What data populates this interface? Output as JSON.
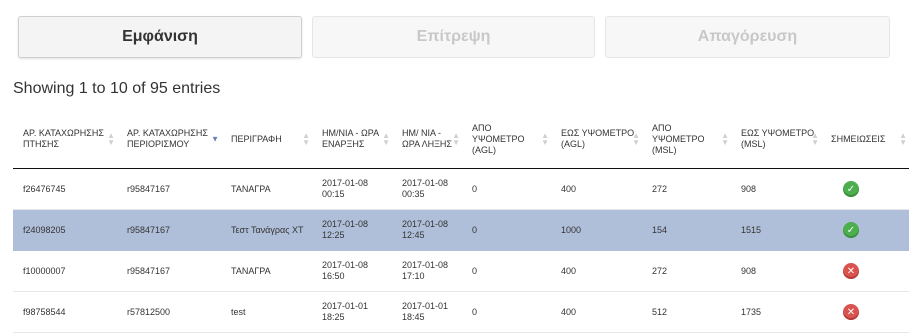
{
  "tabs": [
    {
      "label": "Εμφάνιση",
      "active": true
    },
    {
      "label": "Επίτρεψη",
      "active": false
    },
    {
      "label": "Απαγόρευση",
      "active": false
    }
  ],
  "info": "Showing 1 to 10 of 95 entries",
  "columns": [
    {
      "label": "ΑΡ. ΚΑΤΑΧΩΡΗΣΗΣ ΠΤΗΣΗΣ",
      "sort": "both"
    },
    {
      "label": "ΑΡ. ΚΑΤΑΧΩΡΗΣΗΣ ΠΕΡΙΟΡΙΣΜΟΥ",
      "sort": "desc"
    },
    {
      "label": "ΠΕΡΙΓΡΑΦΗ",
      "sort": "both"
    },
    {
      "label": "ΗΜ/ΝΙΑ - ΩΡΑ ΕΝΑΡΞΗΣ",
      "sort": "both"
    },
    {
      "label": "ΗΜ/ ΝΙΑ - ΩΡΑ ΛΗΞΗΣ",
      "sort": "both"
    },
    {
      "label": "ΑΠΟ ΥΨΟΜΕΤΡΟ (AGL)",
      "sort": "both"
    },
    {
      "label": "ΕΩΣ ΥΨΟΜΕΤΡΟ (AGL)",
      "sort": "both"
    },
    {
      "label": "ΑΠΟ ΥΨΟΜΕΤΡΟ (MSL)",
      "sort": "both"
    },
    {
      "label": "ΕΩΣ ΥΨΟΜΕΤΡΟ (MSL)",
      "sort": "both"
    },
    {
      "label": "ΣΗΜΕΙΩΣΕΙΣ",
      "sort": "both"
    }
  ],
  "rows": [
    {
      "flight": "f26476745",
      "restriction": "r95847167",
      "desc": "ΤΑΝΑΓΡΑ",
      "start": "2017-01-08 00:15",
      "end": "2017-01-08 00:35",
      "from_agl": "0",
      "to_agl": "400",
      "from_msl": "272",
      "to_msl": "908",
      "status": "ok",
      "selected": false
    },
    {
      "flight": "f24098205",
      "restriction": "r95847167",
      "desc": "Τεστ Τανάγρας ΧΤ",
      "start": "2017-01-08 12:25",
      "end": "2017-01-08 12:45",
      "from_agl": "0",
      "to_agl": "1000",
      "from_msl": "154",
      "to_msl": "1515",
      "status": "ok",
      "selected": true
    },
    {
      "flight": "f10000007",
      "restriction": "r95847167",
      "desc": "ΤΑΝΑΓΡΑ",
      "start": "2017-01-08 16:50",
      "end": "2017-01-08 17:10",
      "from_agl": "0",
      "to_agl": "400",
      "from_msl": "272",
      "to_msl": "908",
      "status": "bad",
      "selected": false
    },
    {
      "flight": "f98758544",
      "restriction": "r57812500",
      "desc": "test",
      "start": "2017-01-01 18:25",
      "end": "2017-01-01 18:45",
      "from_agl": "0",
      "to_agl": "400",
      "from_msl": "512",
      "to_msl": "1735",
      "status": "bad",
      "selected": false
    }
  ],
  "colors": {
    "selected_row": "#b0bfd9",
    "ok": "#4cae4c",
    "bad": "#d9534f"
  },
  "icons": {
    "ok": "check-circle-icon",
    "bad": "x-circle-icon",
    "sort": "sort-arrows-icon"
  }
}
